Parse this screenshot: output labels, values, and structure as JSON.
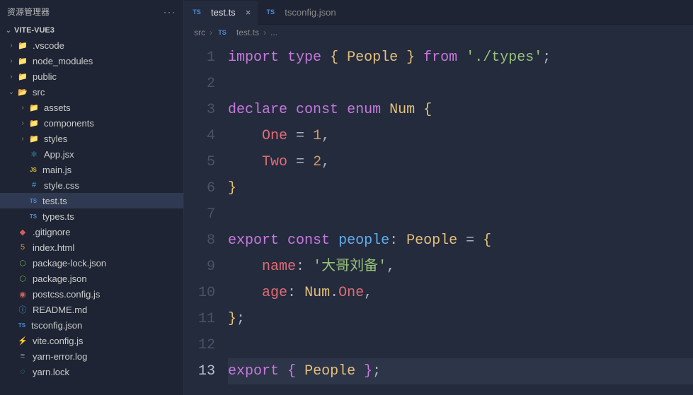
{
  "sidebar": {
    "title": "资源管理器",
    "project": "VITE-VUE3",
    "items": [
      {
        "label": ".vscode",
        "icon": "folder",
        "iconClass": "c-blue",
        "depth": 0,
        "expanded": false,
        "type": "dir"
      },
      {
        "label": "node_modules",
        "icon": "folder",
        "iconClass": "c-folder",
        "depth": 0,
        "expanded": false,
        "type": "dir"
      },
      {
        "label": "public",
        "icon": "folder",
        "iconClass": "c-folder",
        "depth": 0,
        "expanded": false,
        "type": "dir"
      },
      {
        "label": "src",
        "icon": "folder-open",
        "iconClass": "c-folder",
        "depth": 0,
        "expanded": true,
        "type": "dir"
      },
      {
        "label": "assets",
        "icon": "folder",
        "iconClass": "c-yellow",
        "depth": 1,
        "expanded": false,
        "type": "dir"
      },
      {
        "label": "components",
        "icon": "folder",
        "iconClass": "c-yellow",
        "depth": 1,
        "expanded": false,
        "type": "dir"
      },
      {
        "label": "styles",
        "icon": "folder",
        "iconClass": "c-blue",
        "depth": 1,
        "expanded": false,
        "type": "dir"
      },
      {
        "label": "App.jsx",
        "icon": "react",
        "iconClass": "c-cyan",
        "depth": 1,
        "type": "file"
      },
      {
        "label": "main.js",
        "icon": "js",
        "iconClass": "c-yel2",
        "depth": 1,
        "type": "file"
      },
      {
        "label": "style.css",
        "icon": "css",
        "iconClass": "c-blue",
        "depth": 1,
        "type": "file"
      },
      {
        "label": "test.ts",
        "icon": "ts",
        "iconClass": "c-blue2",
        "depth": 1,
        "type": "file",
        "active": true
      },
      {
        "label": "types.ts",
        "icon": "ts",
        "iconClass": "c-blue2",
        "depth": 1,
        "type": "file"
      },
      {
        "label": ".gitignore",
        "icon": "git",
        "iconClass": "c-red",
        "depth": 0,
        "type": "file"
      },
      {
        "label": "index.html",
        "icon": "html",
        "iconClass": "c-orange",
        "depth": 0,
        "type": "file"
      },
      {
        "label": "package-lock.json",
        "icon": "npm",
        "iconClass": "c-green",
        "depth": 0,
        "type": "file"
      },
      {
        "label": "package.json",
        "icon": "npm",
        "iconClass": "c-green",
        "depth": 0,
        "type": "file"
      },
      {
        "label": "postcss.config.js",
        "icon": "postcss",
        "iconClass": "c-red",
        "depth": 0,
        "type": "file"
      },
      {
        "label": "README.md",
        "icon": "info",
        "iconClass": "c-blue",
        "depth": 0,
        "type": "file"
      },
      {
        "label": "tsconfig.json",
        "icon": "ts",
        "iconClass": "c-blue2",
        "depth": 0,
        "type": "file"
      },
      {
        "label": "vite.config.js",
        "icon": "vite",
        "iconClass": "c-yel2",
        "depth": 0,
        "type": "file"
      },
      {
        "label": "yarn-error.log",
        "icon": "log",
        "iconClass": "c-grey",
        "depth": 0,
        "type": "file"
      },
      {
        "label": "yarn.lock",
        "icon": "yarn",
        "iconClass": "c-blue",
        "depth": 0,
        "type": "file"
      }
    ]
  },
  "tabs": [
    {
      "label": "test.ts",
      "icon": "ts",
      "active": true
    },
    {
      "label": "tsconfig.json",
      "icon": "ts",
      "active": false
    }
  ],
  "breadcrumbs": {
    "p0": "src",
    "p1": "test.ts",
    "p2": "..."
  },
  "code": {
    "lines": [
      {
        "n": 1,
        "html": "<span class='k1'>import</span> <span class='k2'>type</span> <span class='br'>{</span> <span class='ty'>People</span> <span class='br'>}</span> <span class='k1'>from</span> <span class='st'>'./types'</span><span class='pu'>;</span>"
      },
      {
        "n": 2,
        "html": ""
      },
      {
        "n": 3,
        "html": "<span class='k1'>declare</span> <span class='k2'>const</span> <span class='k2'>enum</span> <span class='ty'>Num</span> <span class='br'>{</span>"
      },
      {
        "n": 4,
        "html": "    <span class='va'>One</span> <span class='pu'>=</span> <span class='nm'>1</span><span class='pu'>,</span>"
      },
      {
        "n": 5,
        "html": "    <span class='va'>Two</span> <span class='pu'>=</span> <span class='nm'>2</span><span class='pu'>,</span>"
      },
      {
        "n": 6,
        "html": "<span class='br'>}</span>"
      },
      {
        "n": 7,
        "html": ""
      },
      {
        "n": 8,
        "html": "<span class='k1'>export</span> <span class='k2'>const</span> <span class='fn'>people</span><span class='pu'>:</span> <span class='ty'>People</span> <span class='pu'>=</span> <span class='br'>{</span>"
      },
      {
        "n": 9,
        "html": "    <span class='va'>name</span><span class='pu'>:</span> <span class='st'>'大哥刘备'</span><span class='pu'>,</span>"
      },
      {
        "n": 10,
        "html": "    <span class='va'>age</span><span class='pu'>:</span> <span class='ty'>Num</span><span class='pu'>.</span><span class='va'>One</span><span class='pu'>,</span>"
      },
      {
        "n": 11,
        "html": "<span class='br'>}</span><span class='pu'>;</span>"
      },
      {
        "n": 12,
        "html": ""
      },
      {
        "n": 13,
        "html": "<span class='k1'>export</span> <span class='br2'>{</span> <span class='ty'>People</span> <span class='br2'>}</span><span class='pu'>;</span>",
        "cur": true
      }
    ]
  },
  "iconGlyphs": {
    "folder": "📁",
    "folder-open": "📂",
    "react": "⚛",
    "js": "JS",
    "css": "#",
    "ts": "TS",
    "git": "◆",
    "html": "5",
    "npm": "⬡",
    "postcss": "◉",
    "info": "ⓘ",
    "vite": "⚡",
    "log": "≡",
    "yarn": "◌"
  }
}
